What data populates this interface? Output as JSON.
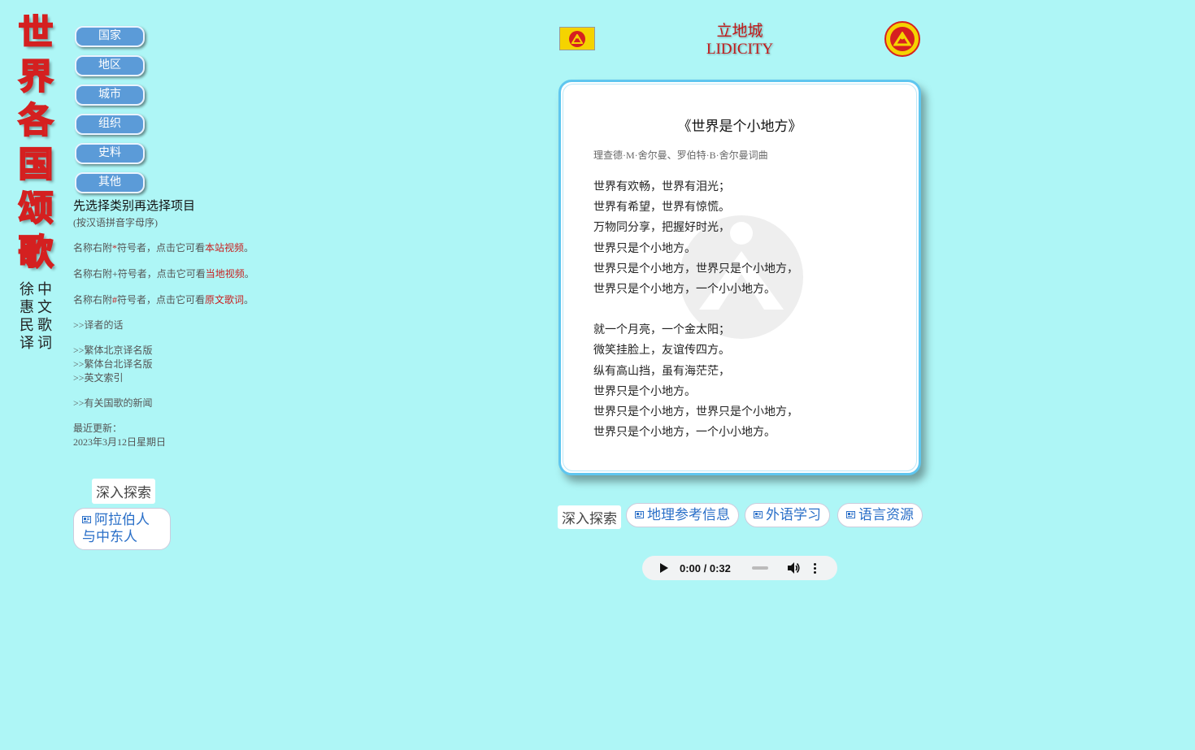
{
  "brand": {
    "title_chars": [
      "世",
      "界",
      "各",
      "国",
      "颂",
      "歌"
    ],
    "subtitle_right_col": [
      "中",
      "文",
      "歌",
      "词"
    ],
    "subtitle_left_col": [
      "徐",
      "惠",
      "民",
      "译"
    ]
  },
  "nav": {
    "items": [
      {
        "label": "国家"
      },
      {
        "label": "地区"
      },
      {
        "label": "城市"
      },
      {
        "label": "组织"
      },
      {
        "label": "史料"
      },
      {
        "label": "其他"
      }
    ]
  },
  "info": {
    "heading": "先选择类别再选择项目",
    "sort_note": "(按汉语拼音字母序)",
    "hint_star_prefix": "名称右附",
    "hint_star_symbol": "*",
    "hint_star_middle": "符号者，点击它可看",
    "hint_star_link": "本站视频",
    "hint_plus_prefix": "名称右附+符号者，点击它可看",
    "hint_plus_link": "当地视频",
    "hint_hash_prefix": "名称右附",
    "hint_hash_symbol": "#",
    "hint_hash_middle": "符号者，点击它可看",
    "hint_hash_link": "原文歌词",
    "period": "。",
    "translator_note": ">>译者的话",
    "trad_beijing": ">>繁体北京译名版",
    "trad_taipei": ">>繁体台北译名版",
    "english_index": ">>英文索引",
    "anthem_news": ">>有关国歌的新闻",
    "updated_label": "最近更新：",
    "updated_date": "2023年3月12日星期日"
  },
  "left_explore": {
    "label": "深入探索",
    "topic": "阿拉伯人与中东人"
  },
  "header": {
    "site_name_cn": "立地城",
    "site_name_en": "LIDICITY"
  },
  "song": {
    "title": "《世界是个小地方》",
    "credit": "理查德·M·舍尔曼、罗伯特·B·舍尔曼词曲",
    "stanza1": [
      "世界有欢畅，世界有泪光；",
      "世界有希望，世界有惊慌。",
      "万物同分享，把握好时光，",
      "世界只是个小地方。",
      "世界只是个小地方，世界只是个小地方，",
      "世界只是个小地方，一个小小地方。"
    ],
    "stanza2": [
      "就一个月亮，一个金太阳；",
      "微笑挂脸上，友谊传四方。",
      "纵有高山挡，虽有海茫茫，",
      "世界只是个小地方。",
      "世界只是个小地方，世界只是个小地方，",
      "世界只是个小地方，一个小小地方。"
    ]
  },
  "bottom": {
    "explore_label": "深入探索",
    "pills": [
      "地理参考信息",
      "外语学习",
      "语言资源"
    ]
  },
  "audio": {
    "time": "0:00 / 0:32"
  },
  "colors": {
    "background": "#aef6f6",
    "nav_button": "#5b9bd8",
    "accent_red": "#c21a1a",
    "link_blue": "#2a6fc8",
    "card_border": "#5fc6ef"
  }
}
